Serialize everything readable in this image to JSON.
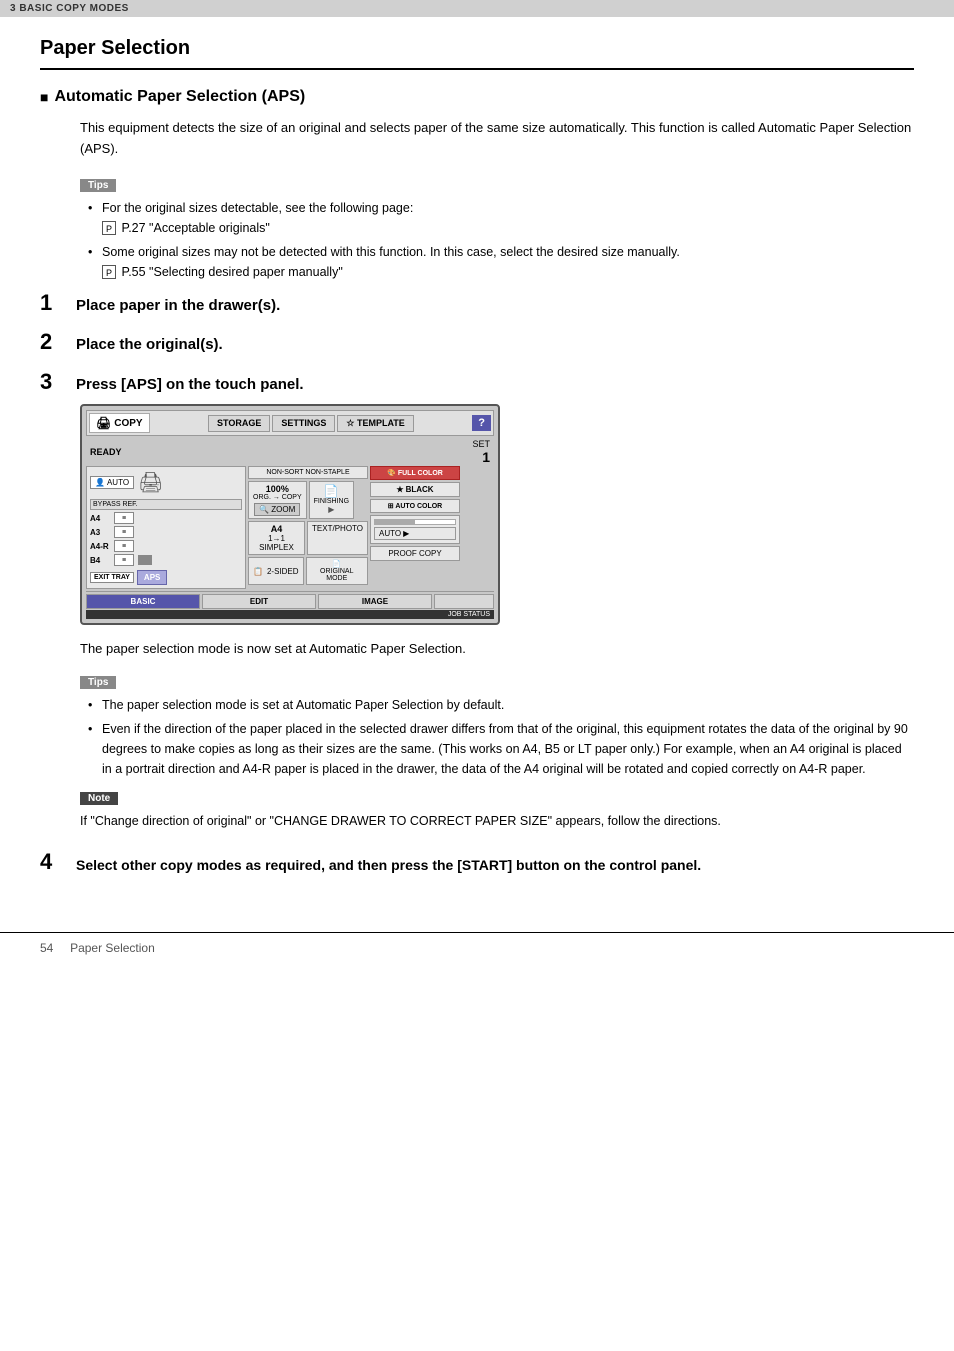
{
  "topbar": {
    "label": "3 BASIC COPY MODES"
  },
  "page": {
    "title": "Paper Selection",
    "section_title": "Automatic Paper Selection (APS)",
    "intro": "This equipment detects the size of an original and selects paper of the same size automatically. This function is called Automatic Paper Selection (APS).",
    "tips_label": "Tips",
    "tips1": [
      {
        "text": "For the original sizes detectable, see the following page:",
        "ref": "P.27 \"Acceptable originals\""
      },
      {
        "text": "Some original sizes may not be detected with this function. In this case, select the desired size manually.",
        "ref": "P.55 \"Selecting desired paper manually\""
      }
    ],
    "step1": {
      "number": "1",
      "text": "Place paper in the drawer(s)."
    },
    "step2": {
      "number": "2",
      "text": "Place the original(s)."
    },
    "step3": {
      "number": "3",
      "text": "Press [APS] on the touch panel."
    },
    "after_panel": "The paper selection mode is now set at Automatic Paper Selection.",
    "tips2_label": "Tips",
    "tips2": [
      {
        "text": "The paper selection mode is set at Automatic Paper Selection by default."
      },
      {
        "text": "Even if the direction of the paper placed in the selected drawer differs from that of the original, this equipment rotates the data of the original by 90 degrees to make copies as long as their sizes are the same. (This works on A4, B5 or LT paper only.) For example, when an A4 original is placed in a portrait direction and A4-R paper is placed in the drawer, the data of the A4 original will be rotated and copied correctly on A4-R paper."
      }
    ],
    "note_label": "Note",
    "note_text": "If \"Change direction of original\" or \"CHANGE DRAWER TO CORRECT PAPER SIZE\" appears, follow the directions.",
    "step4": {
      "number": "4",
      "text": "Select other copy modes as required, and then press the [START] button on the control panel."
    }
  },
  "touch_panel": {
    "header": {
      "copy_label": "COPY",
      "storage": "STORAGE",
      "settings": "SETTINGS",
      "template": "TEMPLATE",
      "question": "?"
    },
    "status": {
      "ready": "READY",
      "set": "SET",
      "number": "1"
    },
    "left": {
      "auto_label": "AUTO",
      "bypass": "BYPASS REF.",
      "drawers": [
        {
          "label": "A4"
        },
        {
          "label": "A3"
        },
        {
          "label": "A4-R"
        },
        {
          "label": "B4"
        }
      ],
      "exit_tray": "EXIT TRAY",
      "aps": "APS"
    },
    "middle": {
      "percent": "100%",
      "org_copy": "ORG. → COPY",
      "zoom": "ZOOM",
      "finishing": "FINISHING",
      "simplex": "1→1 SIMPLEX",
      "text_photo": "TEXT/PHOTO",
      "two_sided": "2-SIDED",
      "original_mode": "ORIGINAL MODE",
      "nonsort": "NON-SORT NON-STAPLE",
      "a4_label": "A4"
    },
    "right": {
      "full_color": "FULL COLOR",
      "black": "BLACK",
      "auto_color": "AUTO COLOR",
      "auto": "AUTO",
      "proof_copy": "PROOF COPY"
    },
    "footer": {
      "basic": "BASIC",
      "edit": "EDIT",
      "image": "IMAGE",
      "job_status": "JOB STATUS"
    }
  },
  "footer": {
    "page_num": "54",
    "page_label": "Paper Selection"
  }
}
